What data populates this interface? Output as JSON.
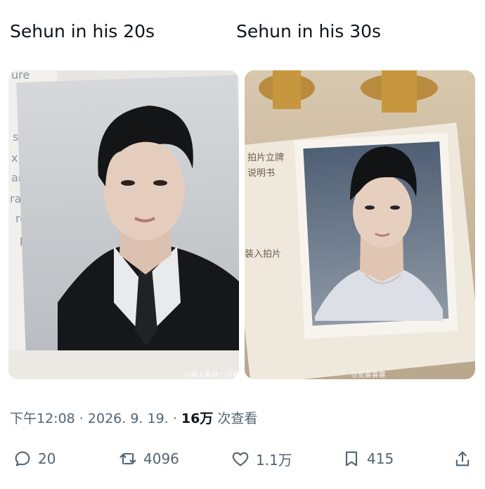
{
  "captions": {
    "left": "Sehun in his 20s",
    "right": "Sehun in his 30s"
  },
  "photos": {
    "left": {
      "watermark": "◎海上森林一只猫"
    },
    "right": {
      "watermark": "◎安雾雾雾"
    }
  },
  "meta": {
    "time": "下午12:08",
    "sep1": " · ",
    "date": "2026. 9. 19.",
    "sep2": " · ",
    "views": "16万",
    "views_suffix": " 次查看"
  },
  "actions": {
    "reply": "20",
    "retweet": "4096",
    "like": "1.1万",
    "bookmark": "415"
  },
  "colors": {
    "text": "#0f1419",
    "muted": "#536471"
  }
}
